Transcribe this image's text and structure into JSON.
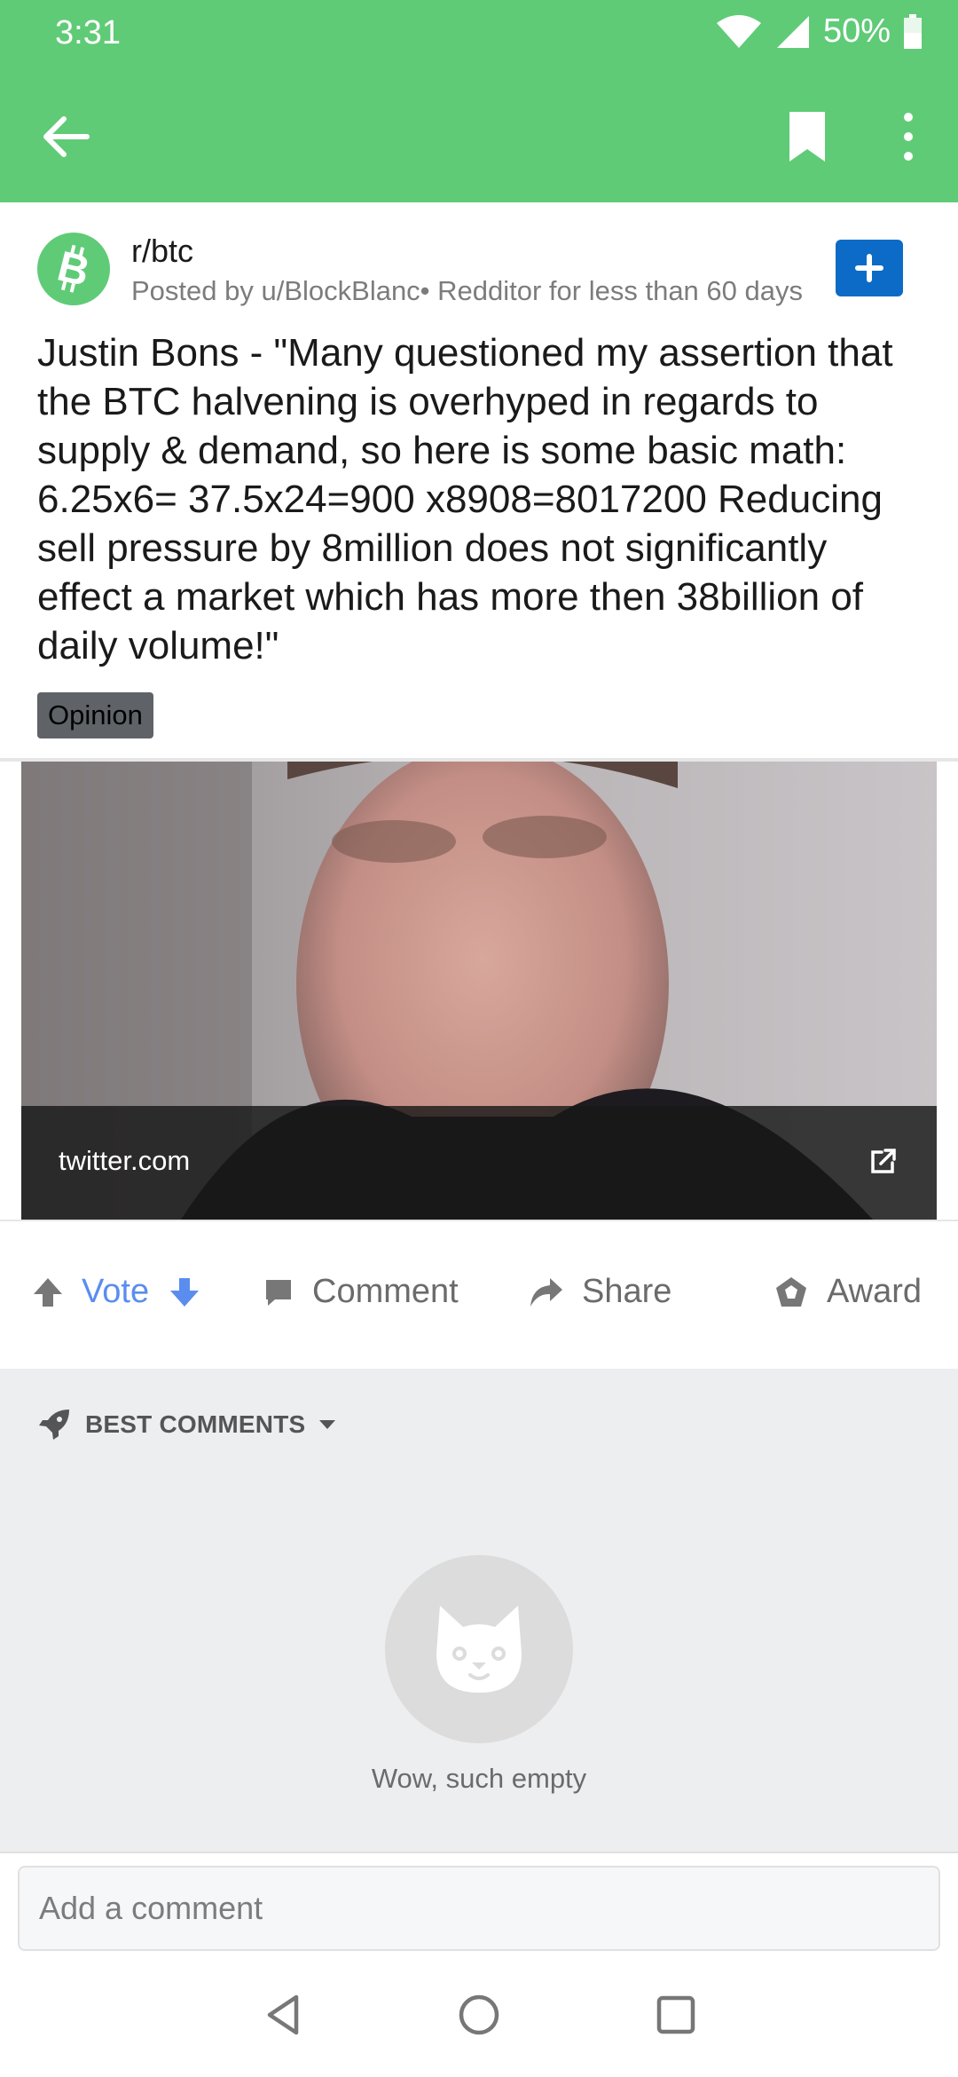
{
  "status": {
    "time": "3:31",
    "battery_pct": "50%"
  },
  "appbar": {
    "back_icon": "back-arrow-icon",
    "bookmark_icon": "bookmark-icon",
    "more_icon": "more-vertical-icon"
  },
  "post": {
    "subreddit": "r/btc",
    "meta": "Posted by u/BlockBlanc• Redditor for less than 60 days",
    "title": "Justin Bons - \"Many questioned my assertion that the BTC halvening is overhyped in regards to supply & demand, so here is some basic math: 6.25x6= 37.5x24=900 x8908=8017200 Reducing sell pressure by 8million does not significantly effect a market which has more then 38billion of daily volume!\"",
    "flair": "Opinion",
    "link_domain": "twitter.com"
  },
  "actions": {
    "vote": "Vote",
    "comment": "Comment",
    "share": "Share",
    "award": "Award"
  },
  "comments": {
    "sort_label": "BEST COMMENTS",
    "empty_text": "Wow, such empty"
  },
  "composer": {
    "placeholder": "Add a comment"
  },
  "colors": {
    "brand_green": "#5fcb77",
    "join_blue": "#0b6bc7",
    "vote_blue": "#5b8def",
    "flair_gray": "#5f6368"
  }
}
